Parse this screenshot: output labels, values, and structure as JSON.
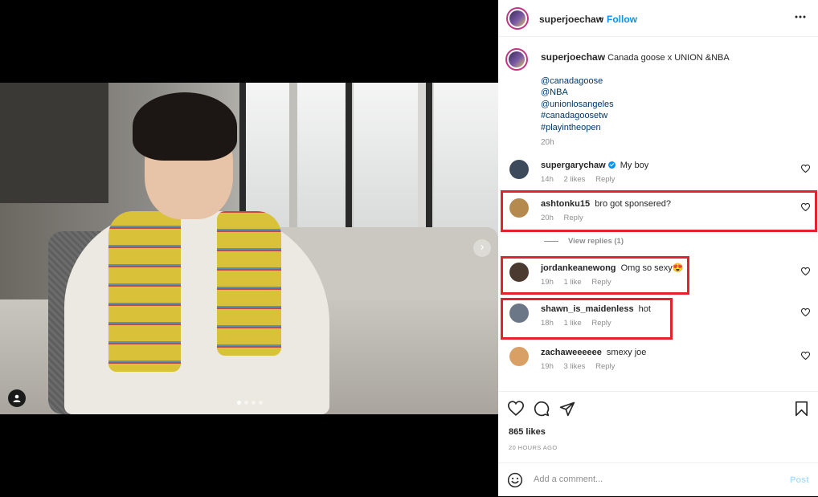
{
  "post": {
    "author": "superjoechaw",
    "follow_label": "Follow",
    "separator": "•",
    "more_label": "•••",
    "caption": {
      "text": "Canada goose x UNION &NBA",
      "tags": [
        "@canadagoose",
        "@NBA",
        "@unionlosangeles",
        "#canadagoosetw",
        "#playintheopen"
      ],
      "time": "20h"
    }
  },
  "media": {
    "carousel_dots": 4,
    "active_dot": 0,
    "next_arrow": "›"
  },
  "comments": [
    {
      "user": "supergarychaw",
      "verified": true,
      "text": "My boy",
      "time": "14h",
      "likes": "2 likes",
      "reply": "Reply",
      "avatar_color": "#3d4a5c"
    },
    {
      "user": "ashtonku15",
      "verified": false,
      "text": "bro got sponsered?",
      "time": "20h",
      "likes": "",
      "reply": "Reply",
      "avatar_color": "#b58a4e"
    },
    {
      "user": "jordankeanewong",
      "verified": false,
      "text": "Omg so sexy😍",
      "time": "19h",
      "likes": "1 like",
      "reply": "Reply",
      "avatar_color": "#4b3a30"
    },
    {
      "user": "shawn_is_maidenless",
      "verified": false,
      "text": "hot",
      "time": "18h",
      "likes": "1 like",
      "reply": "Reply",
      "avatar_color": "#6b7787"
    },
    {
      "user": "zachaweeeeee",
      "verified": false,
      "text": "smexy joe",
      "time": "19h",
      "likes": "3 likes",
      "reply": "Reply",
      "avatar_color": "#d9a066"
    }
  ],
  "view_replies": "View replies (1)",
  "likes_count": "865 likes",
  "post_date": "20 HOURS AGO",
  "add_comment": {
    "placeholder": "Add a comment...",
    "post_label": "Post"
  },
  "highlight_color": "#e2222d"
}
